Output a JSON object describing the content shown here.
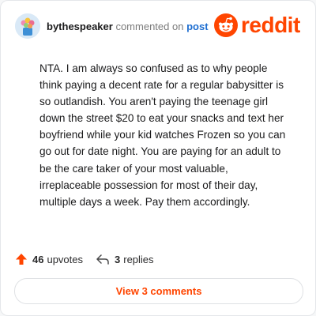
{
  "comment": {
    "username": "bythespeaker",
    "action_text": "commented on",
    "post_link": "post",
    "body": "NTA. I am always so confused as to why people think paying a decent rate for a regular babysitter is so outlandish. You aren't paying the teenage girl down the street $20 to eat your snacks and text her boyfriend while your kid watches Frozen so you can go out for date night. You are paying for an adult to be the care taker of your most valuable, irreplaceable possession for most of their day, multiple days a week. Pay them accordingly.",
    "upvotes_count": "46",
    "upvotes_label": "upvotes",
    "replies_count": "3",
    "replies_label": "replies"
  },
  "brand": {
    "wordmark": "reddit",
    "accent_color": "#ff4500"
  },
  "footer": {
    "view_comments_label": "View 3 comments"
  },
  "icons": {
    "avatar": "flower-bouquet-avatar",
    "logo": "reddit-snoo-icon",
    "upvote": "upvote-arrow-icon",
    "reply": "reply-arrow-icon"
  }
}
